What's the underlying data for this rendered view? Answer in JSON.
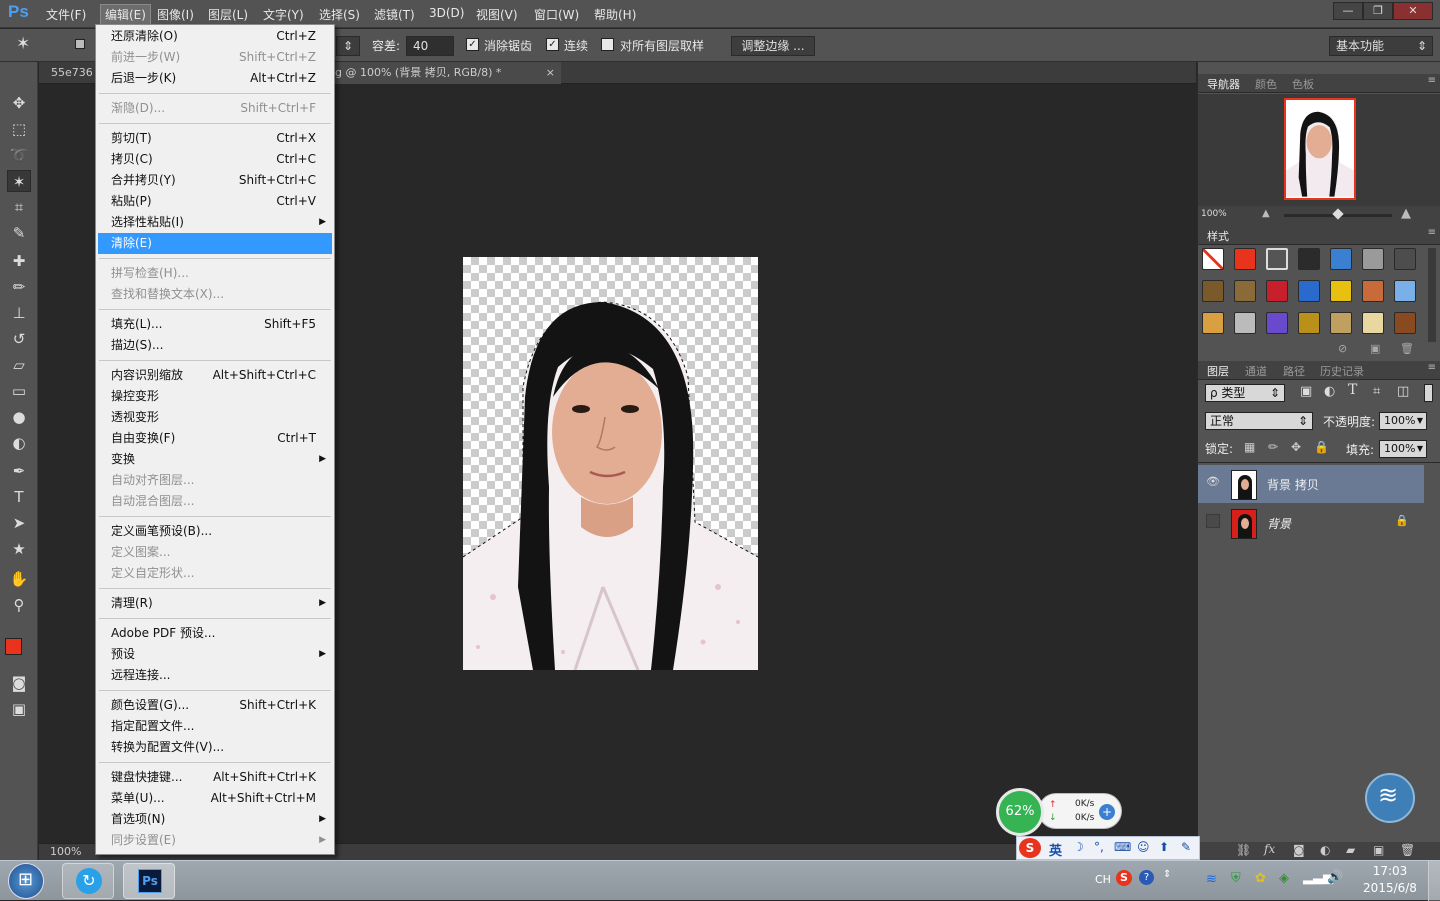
{
  "app": {
    "logo": "Ps"
  },
  "menubar": {
    "items": [
      "文件(F)",
      "编辑(E)",
      "图像(I)",
      "图层(L)",
      "文字(Y)",
      "选择(S)",
      "滤镜(T)",
      "3D(D)",
      "视图(V)",
      "窗口(W)",
      "帮助(H)"
    ],
    "active_index": 1
  },
  "window_controls": {
    "minimize": "—",
    "restore": "❐",
    "close": "✕"
  },
  "options": {
    "tolerance_label": "容差:",
    "tolerance_value": "40",
    "antialias_label": "消除锯齿",
    "contiguous_label": "连续",
    "sample_all_label": "对所有图层取样",
    "antialias_checked": true,
    "contiguous_checked": true,
    "sample_all_checked": false,
    "refine_edge_label": "调整边缘 ...",
    "workspace": "基本功能"
  },
  "doc_tabs": {
    "tab1": "55e736",
    "tab2": "g @ 100% (背景 拷贝, RGB/8) *",
    "close": "×"
  },
  "status": {
    "zoom": "100%"
  },
  "edit_menu": {
    "groups": [
      [
        {
          "label": "还原清除(O)",
          "shortcut": "Ctrl+Z",
          "disabled": false
        },
        {
          "label": "前进一步(W)",
          "shortcut": "Shift+Ctrl+Z",
          "disabled": true
        },
        {
          "label": "后退一步(K)",
          "shortcut": "Alt+Ctrl+Z",
          "disabled": false
        }
      ],
      [
        {
          "label": "渐隐(D)...",
          "shortcut": "Shift+Ctrl+F",
          "disabled": true
        }
      ],
      [
        {
          "label": "剪切(T)",
          "shortcut": "Ctrl+X",
          "disabled": false
        },
        {
          "label": "拷贝(C)",
          "shortcut": "Ctrl+C",
          "disabled": false
        },
        {
          "label": "合并拷贝(Y)",
          "shortcut": "Shift+Ctrl+C",
          "disabled": false
        },
        {
          "label": "粘贴(P)",
          "shortcut": "Ctrl+V",
          "disabled": false
        },
        {
          "label": "选择性粘贴(I)",
          "shortcut": "",
          "submenu": true,
          "disabled": false
        },
        {
          "label": "清除(E)",
          "shortcut": "",
          "highlighted": true,
          "disabled": false
        }
      ],
      [
        {
          "label": "拼写检查(H)...",
          "shortcut": "",
          "disabled": true
        },
        {
          "label": "查找和替换文本(X)...",
          "shortcut": "",
          "disabled": true
        }
      ],
      [
        {
          "label": "填充(L)...",
          "shortcut": "Shift+F5",
          "disabled": false
        },
        {
          "label": "描边(S)...",
          "shortcut": "",
          "disabled": false
        }
      ],
      [
        {
          "label": "内容识别缩放",
          "shortcut": "Alt+Shift+Ctrl+C",
          "disabled": false
        },
        {
          "label": "操控变形",
          "shortcut": "",
          "disabled": false
        },
        {
          "label": "透视变形",
          "shortcut": "",
          "disabled": false
        },
        {
          "label": "自由变换(F)",
          "shortcut": "Ctrl+T",
          "disabled": false
        },
        {
          "label": "变换",
          "shortcut": "",
          "submenu": true,
          "disabled": false
        },
        {
          "label": "自动对齐图层...",
          "shortcut": "",
          "disabled": true
        },
        {
          "label": "自动混合图层...",
          "shortcut": "",
          "disabled": true
        }
      ],
      [
        {
          "label": "定义画笔预设(B)...",
          "shortcut": "",
          "disabled": false
        },
        {
          "label": "定义图案...",
          "shortcut": "",
          "disabled": true
        },
        {
          "label": "定义自定形状...",
          "shortcut": "",
          "disabled": true
        }
      ],
      [
        {
          "label": "清理(R)",
          "shortcut": "",
          "submenu": true,
          "disabled": false
        }
      ],
      [
        {
          "label": "Adobe PDF 预设...",
          "shortcut": "",
          "disabled": false
        },
        {
          "label": "预设",
          "shortcut": "",
          "submenu": true,
          "disabled": false
        },
        {
          "label": "远程连接...",
          "shortcut": "",
          "disabled": false
        }
      ],
      [
        {
          "label": "颜色设置(G)...",
          "shortcut": "Shift+Ctrl+K",
          "disabled": false
        },
        {
          "label": "指定配置文件...",
          "shortcut": "",
          "disabled": false
        },
        {
          "label": "转换为配置文件(V)...",
          "shortcut": "",
          "disabled": false
        }
      ],
      [
        {
          "label": "键盘快捷键...",
          "shortcut": "Alt+Shift+Ctrl+K",
          "disabled": false
        },
        {
          "label": "菜单(U)...",
          "shortcut": "Alt+Shift+Ctrl+M",
          "disabled": false
        },
        {
          "label": "首选项(N)",
          "shortcut": "",
          "submenu": true,
          "disabled": false
        },
        {
          "label": "同步设置(E)",
          "shortcut": "",
          "submenu": true,
          "disabled": true
        }
      ]
    ]
  },
  "navigator": {
    "tabs": [
      "导航器",
      "颜色",
      "色板"
    ],
    "zoom": "100%"
  },
  "styles": {
    "title": "样式",
    "colors": [
      "#ffffff",
      "#e8341c",
      "#555555",
      "#2b2b2b",
      "#3a7fd0",
      "#9a9a9a",
      "#4d4d4d",
      "#7a5a2a",
      "#8b6a3a",
      "#c8202a",
      "#2a6acc",
      "#e8c010",
      "#c86a3a",
      "#7ab0e8",
      "#d8a040",
      "#bbbbbb",
      "#6a4acc",
      "#b8901a",
      "#c0a060",
      "#e8d8a0",
      "#8a4a20"
    ]
  },
  "layers": {
    "tabs": [
      "图层",
      "通道",
      "路径",
      "历史记录"
    ],
    "filter_kind": "ρ 类型",
    "blend_mode": "正常",
    "opacity_label": "不透明度:",
    "opacity_value": "100%",
    "lock_label": "锁定:",
    "fill_label": "填充:",
    "fill_value": "100%",
    "items": [
      {
        "name": "背景 拷贝",
        "visible": true,
        "selected": true,
        "locked": false
      },
      {
        "name": "背景",
        "visible": false,
        "selected": false,
        "locked": true
      }
    ]
  },
  "net_widget": {
    "percent": "62%",
    "up": "0K/s",
    "down": "0K/s"
  },
  "ime": {
    "mode": "英"
  },
  "taskbar": {
    "lang": "CH",
    "time": "17:03",
    "date": "2015/6/8",
    "ps_label": "Ps"
  }
}
